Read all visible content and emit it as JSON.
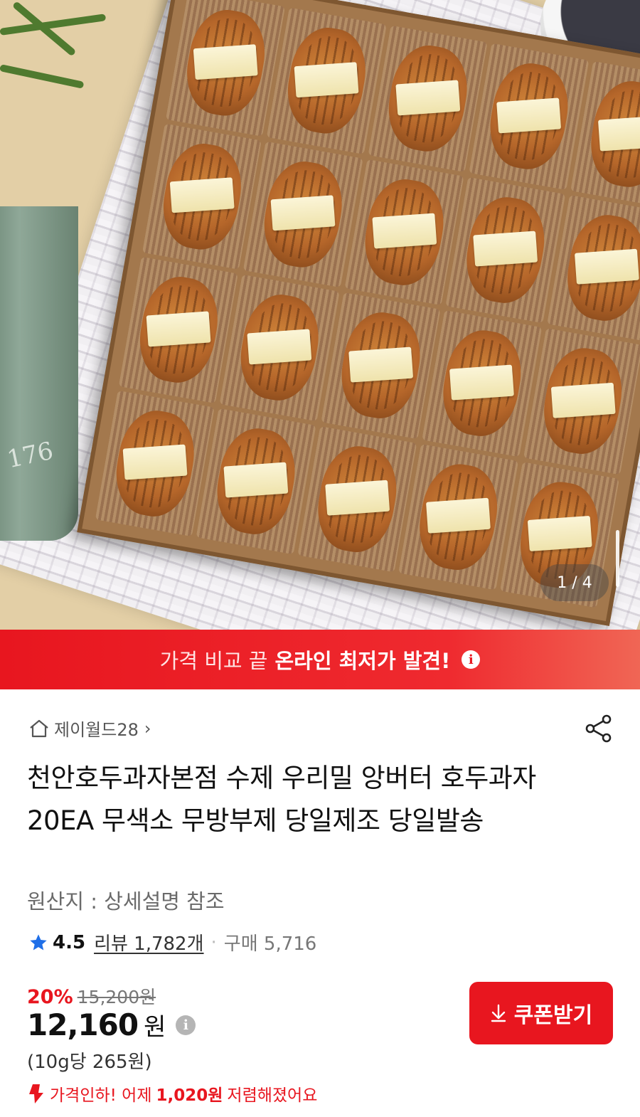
{
  "gallery": {
    "counter": "1 / 4",
    "pot_label": "176",
    "cell_count": 20
  },
  "banner": {
    "text_plain": "가격 비교 끝",
    "text_bold": "온라인 최저가 발견!",
    "info_glyph": "i"
  },
  "seller": {
    "name": "제이월드28",
    "chevron": "›"
  },
  "product": {
    "title": "천안호두과자본점 수제 우리밀 앙버터 호두과자 20EA 무색소 무방부제 당일제조 당일발송",
    "origin": "원산지 : 상세설명 참조"
  },
  "rating": {
    "score": "4.5",
    "reviews": "리뷰 1,782개",
    "separator": "·",
    "purchases": "구매 5,716"
  },
  "pricing": {
    "discount": "20%",
    "original_price": "15,200원",
    "price": "12,160",
    "price_unit": "원",
    "price_info_glyph": "i",
    "per_unit": "(10g당 265원)",
    "drop_prefix": "가격인하! 어제",
    "drop_amount": "1,020원",
    "drop_suffix": "저렴해졌어요"
  },
  "actions": {
    "coupon_label": "쿠폰받기"
  },
  "colors": {
    "brand_red": "#e8161f",
    "star_blue": "#1f6fe8"
  },
  "icons": {
    "home": "house-icon",
    "share": "share-icon",
    "star": "star-icon",
    "download": "download-arrow-icon",
    "price_drop": "down-arrow-icon"
  }
}
